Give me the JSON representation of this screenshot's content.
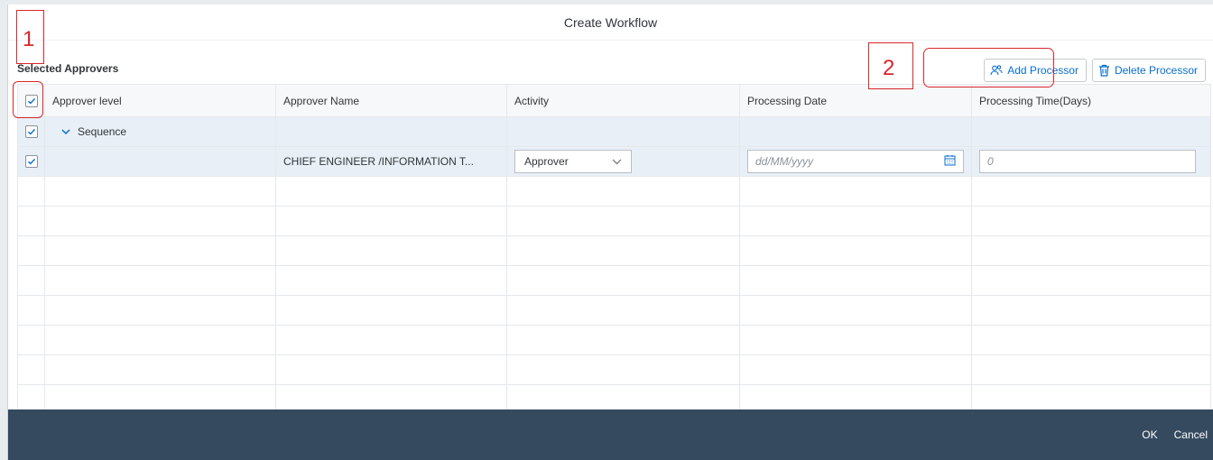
{
  "dialog": {
    "title": "Create Workflow"
  },
  "section": {
    "title": "Selected Approvers"
  },
  "toolbar": {
    "add_processor": "Add Processor",
    "delete_processor": "Delete Processor"
  },
  "table": {
    "columns": [
      "Approver level",
      "Approver Name",
      "Activity",
      "Processing Date",
      "Processing Time(Days)"
    ],
    "sequence_label": "Sequence",
    "row": {
      "approver_name": "CHIEF ENGINEER /INFORMATION T...",
      "activity": "Approver",
      "date_placeholder": "dd/MM/yyyy",
      "time_placeholder": "0"
    }
  },
  "footer": {
    "ok": "OK",
    "cancel": "Cancel"
  },
  "annotations": {
    "one": "1",
    "two": "2"
  },
  "colors": {
    "accent": "#0a6ed1",
    "footer": "#354a5f",
    "annotation": "#d9262c",
    "selected_row": "#e8eff6"
  }
}
